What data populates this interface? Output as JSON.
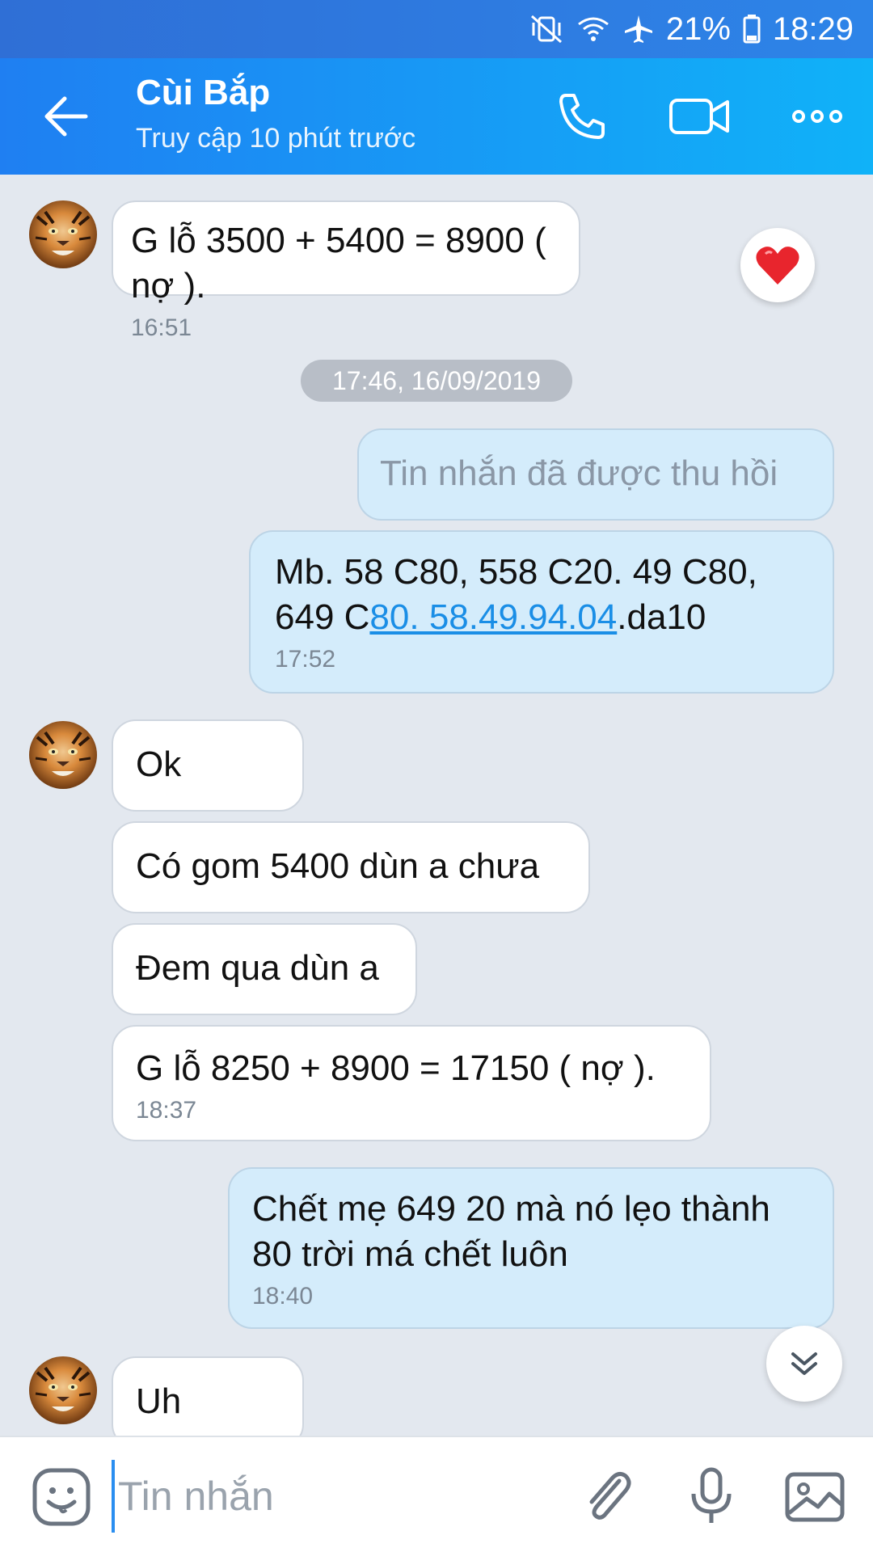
{
  "status": {
    "battery": "21%",
    "clock": "18:29",
    "icons": [
      "vibrate-icon",
      "wifi-icon",
      "airplane-icon",
      "battery-icon"
    ]
  },
  "header": {
    "name": "Cùi Bắp",
    "subtitle": "Truy cập 10 phút trước"
  },
  "date_chip": "17:46, 16/09/2019",
  "messages": [
    {
      "dir": "in",
      "text": "G lỗ 3500 + 5400 = 8900 ( nợ ).",
      "time": "16:51",
      "reaction": "heart"
    },
    {
      "dir": "out",
      "text": "Tin nhắn đã được thu hồi",
      "recalled": true
    },
    {
      "dir": "out",
      "text_parts": [
        "Mb. 58 C80, 558 C20.   49 C80,",
        "649 C",
        "80.   58.49.94.04",
        ".da10"
      ],
      "time": "17:52"
    },
    {
      "dir": "in",
      "text": "Ok"
    },
    {
      "dir": "in",
      "text": "Có gom 5400 dùn a chưa"
    },
    {
      "dir": "in",
      "text": "Đem qua dùn a"
    },
    {
      "dir": "in",
      "text": "G lỗ 8250 + 8900 = 17150 ( nợ ).",
      "time": "18:37"
    },
    {
      "dir": "out",
      "text_lines": [
        "Chết mẹ 649 20 mà nó lẹo thành",
        "80 trời má chết luôn"
      ],
      "time": "18:40"
    },
    {
      "dir": "in",
      "text": "Uh"
    }
  ],
  "composer": {
    "placeholder": "Tin nhắn"
  },
  "colors": {
    "header_start": "#1f7ff2",
    "header_end": "#10b2f8",
    "out_bubble": "#d4ecfb",
    "link": "#1a8ee6"
  }
}
